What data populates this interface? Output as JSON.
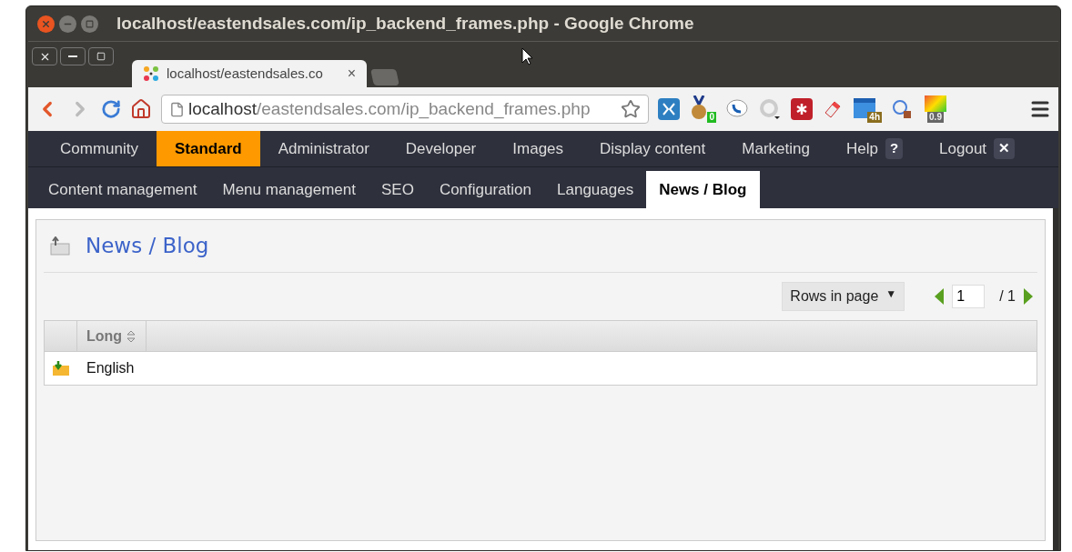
{
  "window": {
    "title": "localhost/eastendsales.com/ip_backend_frames.php - Google Chrome"
  },
  "tab": {
    "title": "localhost/eastendsales.co",
    "close": "×"
  },
  "address_bar": {
    "host": "localhost",
    "path": "/eastendsales.com/ip_backend_frames.php"
  },
  "extension_badges": [
    "0",
    "4h",
    "0.9"
  ],
  "main_menu": [
    {
      "label": "Community",
      "selected": false
    },
    {
      "label": "Standard",
      "selected": true
    },
    {
      "label": "Administrator",
      "selected": false
    },
    {
      "label": "Developer",
      "selected": false
    },
    {
      "label": "Images",
      "selected": false
    },
    {
      "label": "Display content",
      "selected": false
    },
    {
      "label": "Marketing",
      "selected": false
    },
    {
      "label": "Help",
      "selected": false,
      "badge": "?"
    },
    {
      "label": "Logout",
      "selected": false,
      "badge": "✕"
    }
  ],
  "sub_menu": [
    {
      "label": "Content management",
      "selected": false
    },
    {
      "label": "Menu management",
      "selected": false
    },
    {
      "label": "SEO",
      "selected": false
    },
    {
      "label": "Configuration",
      "selected": false
    },
    {
      "label": "Languages",
      "selected": false
    },
    {
      "label": "News / Blog",
      "selected": true
    }
  ],
  "page": {
    "title": "News / Blog"
  },
  "pager": {
    "rows_label": "Rows in page",
    "caret": "▼",
    "page": "1",
    "total": "/ 1"
  },
  "table": {
    "columns": [
      "Long"
    ],
    "rows": [
      {
        "cells": [
          "English"
        ]
      }
    ]
  }
}
